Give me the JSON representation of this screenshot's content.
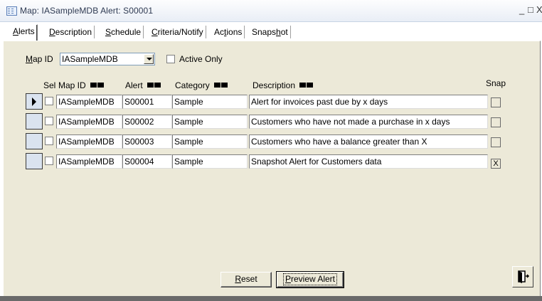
{
  "window": {
    "title": "Map: IASampleMDB   Alert: S00001",
    "minimize_glyph": "_",
    "restore_glyph": "□",
    "close_glyph": "X"
  },
  "tabs": [
    {
      "pre": "",
      "key": "A",
      "post": "lerts"
    },
    {
      "pre": "",
      "key": "D",
      "post": "escription"
    },
    {
      "pre": "",
      "key": "S",
      "post": "chedule"
    },
    {
      "pre": "",
      "key": "C",
      "post": "riteria/Notify"
    },
    {
      "pre": "Ac",
      "key": "t",
      "post": "ions"
    },
    {
      "pre": "Snaps",
      "key": "h",
      "post": "ot"
    }
  ],
  "filter": {
    "map_label_key": "M",
    "map_label_rest": "ap ID",
    "map_value": "IASampleMDB",
    "active_only_label": "Active Only"
  },
  "columns": {
    "sel": "Sel",
    "map_id": "Map ID",
    "alert": "Alert",
    "category": "Category",
    "description": "Description",
    "snap": "Snap"
  },
  "rows": [
    {
      "map_id": "IASampleMDB",
      "alert": "S00001",
      "category": "Sample",
      "description": "Alert for invoices past due by x days",
      "snap": ""
    },
    {
      "map_id": "IASampleMDB",
      "alert": "S00002",
      "category": "Sample",
      "description": "Customers who have not made a purchase in x days",
      "snap": ""
    },
    {
      "map_id": "IASampleMDB",
      "alert": "S00003",
      "category": "Sample",
      "description": "Customers who have a balance greater than X",
      "snap": ""
    },
    {
      "map_id": "IASampleMDB",
      "alert": "S00004",
      "category": "Sample",
      "description": "Snapshot Alert for Customers data",
      "snap": "X"
    }
  ],
  "buttons": {
    "reset_key": "R",
    "reset_rest": "eset",
    "preview_key": "P",
    "preview_rest": "review Alert"
  },
  "icons": {
    "exit": "door-exit-icon",
    "form": "form-icon"
  }
}
